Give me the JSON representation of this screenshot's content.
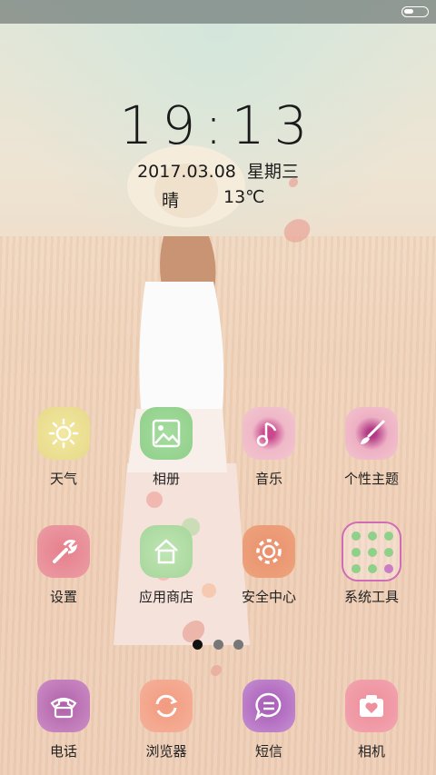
{
  "lockscreen": {
    "time": "19:13",
    "date": "2017.03.08  星期三",
    "weather_condition": "晴",
    "temperature": "13℃"
  },
  "apps_row1": [
    {
      "label": "天气",
      "icon": "sun-icon"
    },
    {
      "label": "相册",
      "icon": "image-icon"
    },
    {
      "label": "音乐",
      "icon": "music-note-icon"
    },
    {
      "label": "个性主题",
      "icon": "paintbrush-icon"
    }
  ],
  "apps_row2": [
    {
      "label": "设置",
      "icon": "wrench-icon"
    },
    {
      "label": "应用商店",
      "icon": "store-icon"
    },
    {
      "label": "安全中心",
      "icon": "gear-icon"
    },
    {
      "label": "系统工具",
      "icon": "folder-grid-icon"
    }
  ],
  "page_indicator": {
    "count": 3,
    "active_index": 0
  },
  "dock": [
    {
      "label": "电话",
      "icon": "phone-icon"
    },
    {
      "label": "浏览器",
      "icon": "refresh-icon"
    },
    {
      "label": "短信",
      "icon": "chat-bubble-icon"
    },
    {
      "label": "相机",
      "icon": "camera-heart-icon"
    }
  ],
  "colors": {
    "text": "#1a1a1a",
    "tools_border": "#cf6cb5"
  }
}
